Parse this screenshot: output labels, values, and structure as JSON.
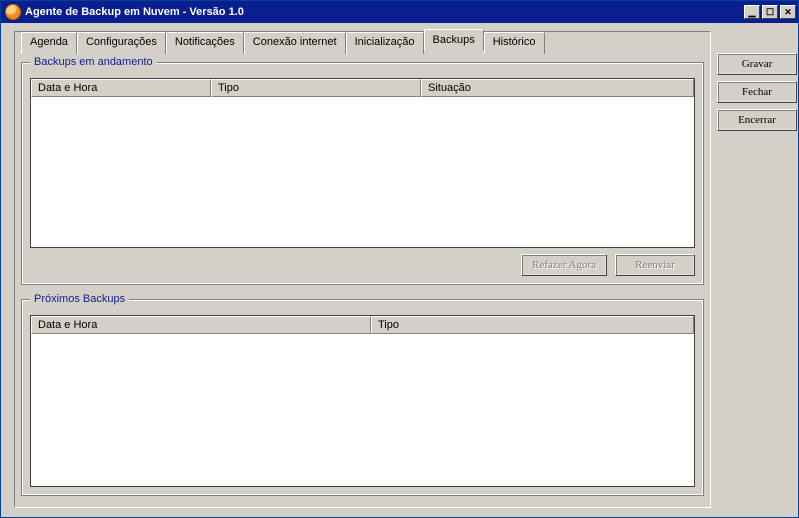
{
  "window": {
    "title": "Agente de Backup em Nuvem - Versão 1.0",
    "minimize": "_",
    "maximize": "□",
    "close": "X"
  },
  "tabs": {
    "agenda": "Agenda",
    "configuracoes": "Configurações",
    "notificacoes": "Notificações",
    "conexao": "Conexão internet",
    "inicializacao": "Inicialização",
    "backups": "Backups",
    "historico": "Histórico",
    "active": "backups"
  },
  "group1": {
    "legend": "Backups em andamento",
    "columns": {
      "datahora": "Data e Hora",
      "tipo": "Tipo",
      "situacao": "Situação"
    },
    "rows": [],
    "buttons": {
      "refazer": "Refazer Agora",
      "reenviar": "Reenviar"
    }
  },
  "group2": {
    "legend": "Próximos Backups",
    "columns": {
      "datahora": "Data e Hora",
      "tipo": "Tipo"
    },
    "rows": []
  },
  "sidebar": {
    "gravar": "Gravar",
    "fechar": "Fechar",
    "encerrar": "Encerrar"
  }
}
